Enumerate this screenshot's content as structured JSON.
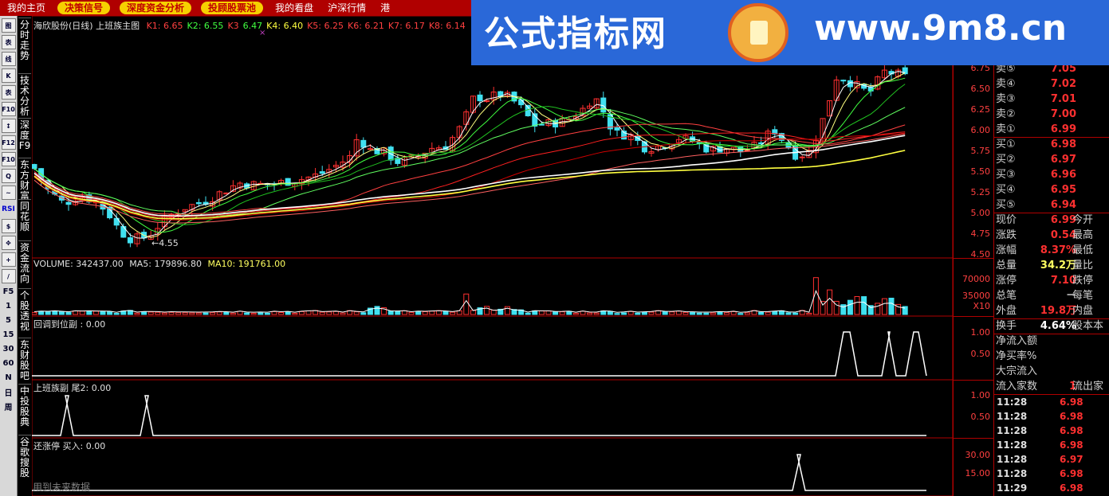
{
  "top_nav": [
    "我的主页",
    "决策信号",
    "深度资金分析",
    "投顾股票池",
    "我的看盘",
    "沪深行情",
    "港"
  ],
  "banner": {
    "title": "公式指标网",
    "url": "www.9m8.cn"
  },
  "left_tools": [
    "图",
    "表",
    "线",
    "K",
    "表",
    "F10",
    "↕",
    "F12",
    "F10",
    "Q",
    "~",
    "RSI",
    "$",
    "✥",
    "+",
    "/",
    "F5",
    "1",
    "5",
    "15",
    "30",
    "60",
    "N",
    "日",
    "周"
  ],
  "left_tabs": [
    "分时走势",
    "技术分析",
    "深度F9",
    "东方财富",
    "同花顺",
    "资金流向",
    "个股透视",
    "东财股吧",
    "中投股典",
    "谷歌搜股"
  ],
  "main": {
    "header": "海欣股份(日线) 上班族主图",
    "k_values": [
      {
        "t": "K1: 6.65",
        "c": "#ff4040"
      },
      {
        "t": "K2: 6.55",
        "c": "#40ff40"
      },
      {
        "t": "K3",
        "c": "#ff4040"
      },
      {
        "t": "6.47",
        "c": "#40ff40"
      },
      {
        "t": "K4: 6.40",
        "c": "#ffff40"
      },
      {
        "t": "K5: 6.25",
        "c": "#ff4040"
      },
      {
        "t": "K6: 6.21",
        "c": "#ff4040"
      },
      {
        "t": "K7: 6.17",
        "c": "#ff4040"
      },
      {
        "t": "K8: 6.14",
        "c": "#ff4040"
      }
    ],
    "low_label": "←4.55",
    "price_ticks": [
      "6.75",
      "6.50",
      "6.25",
      "6.00",
      "5.75",
      "5.50",
      "5.25",
      "5.00",
      "4.75",
      "4.50"
    ]
  },
  "volume": {
    "label": "VOLUME: 342437.00",
    "ma5": "MA5: 179896.80",
    "ma10": "MA10: 191761.00",
    "ticks": [
      "70000",
      "35000"
    ],
    "unit": "X10"
  },
  "panel1": {
    "label": "回调到位副 : 0.00",
    "ticks": [
      "1.00",
      "0.50"
    ]
  },
  "panel2": {
    "label": "上班族副 尾2: 0.00",
    "ticks": [
      "1.00",
      "0.50"
    ]
  },
  "panel3": {
    "label": "还涨停 买入: 0.00",
    "ticks": [
      "30.00",
      "15.00"
    ],
    "footer": "用到未来数据"
  },
  "quote": {
    "asks": [
      {
        "l": "卖⑤",
        "p": "7.05"
      },
      {
        "l": "卖④",
        "p": "7.02"
      },
      {
        "l": "卖③",
        "p": "7.01"
      },
      {
        "l": "卖②",
        "p": "7.00"
      },
      {
        "l": "卖①",
        "p": "6.99"
      }
    ],
    "bids": [
      {
        "l": "买①",
        "p": "6.98"
      },
      {
        "l": "买②",
        "p": "6.97"
      },
      {
        "l": "买③",
        "p": "6.96"
      },
      {
        "l": "买④",
        "p": "6.95"
      },
      {
        "l": "买⑤",
        "p": "6.94"
      }
    ],
    "stats": [
      {
        "l": "现价",
        "v": "6.99",
        "e": "今开",
        "c": "#ff3030"
      },
      {
        "l": "涨跌",
        "v": "0.54",
        "e": "最高",
        "c": "#ff3030"
      },
      {
        "l": "涨幅",
        "v": "8.37%",
        "e": "最低",
        "c": "#ff3030"
      },
      {
        "l": "总量",
        "v": "34.2万",
        "e": "量比",
        "c": "#ffff60"
      },
      {
        "l": "涨停",
        "v": "7.10",
        "e": "跌停",
        "c": "#ff3030"
      },
      {
        "l": "总笔",
        "v": "－",
        "e": "每笔",
        "c": "#d0d0d0"
      },
      {
        "l": "外盘",
        "v": "19.8万",
        "e": "内盘",
        "c": "#ff3030"
      }
    ],
    "turnover": {
      "l": "换手",
      "v": "4.64%",
      "e": "股本本"
    },
    "flow": [
      "净流入额",
      "净买率%",
      "大宗流入"
    ],
    "flow_count": {
      "l": "流入家数",
      "v": "1",
      "e": "流出家"
    },
    "ticks": [
      {
        "t": "11:28",
        "p": "6.98"
      },
      {
        "t": "11:28",
        "p": "6.98"
      },
      {
        "t": "11:28",
        "p": "6.98"
      },
      {
        "t": "11:28",
        "p": "6.98"
      },
      {
        "t": "11:28",
        "p": "6.97"
      },
      {
        "t": "11:28",
        "p": "6.98"
      },
      {
        "t": "11:29",
        "p": "6.98"
      }
    ]
  },
  "colors": {
    "up": "#ff3030",
    "down": "#40e0f0",
    "nav": "#b00000",
    "banner": "#2a68d8"
  }
}
